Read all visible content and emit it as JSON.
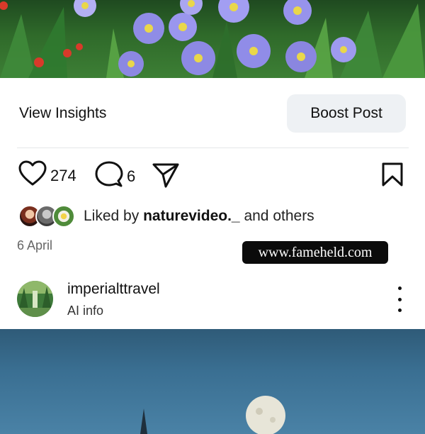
{
  "post": {
    "image_alt": "flower photo"
  },
  "insights": {
    "view_insights_label": "View Insights",
    "boost_post_label": "Boost Post"
  },
  "actions": {
    "like_count": "274",
    "comment_count": "6"
  },
  "liked_by": {
    "prefix": "Liked by ",
    "username": "naturevideo._",
    "suffix": " and others"
  },
  "date": "6 April",
  "watermark": "www.fameheld.com",
  "next_post": {
    "username": "imperialttravel",
    "subtitle": "AI info"
  },
  "colors": {
    "boost_bg": "#eef1f4",
    "divider": "#e4e6e9",
    "watermark_bg": "#0b0b0b"
  },
  "icons": [
    "heart-icon",
    "comment-icon",
    "share-icon",
    "bookmark-icon",
    "more-options-icon"
  ]
}
